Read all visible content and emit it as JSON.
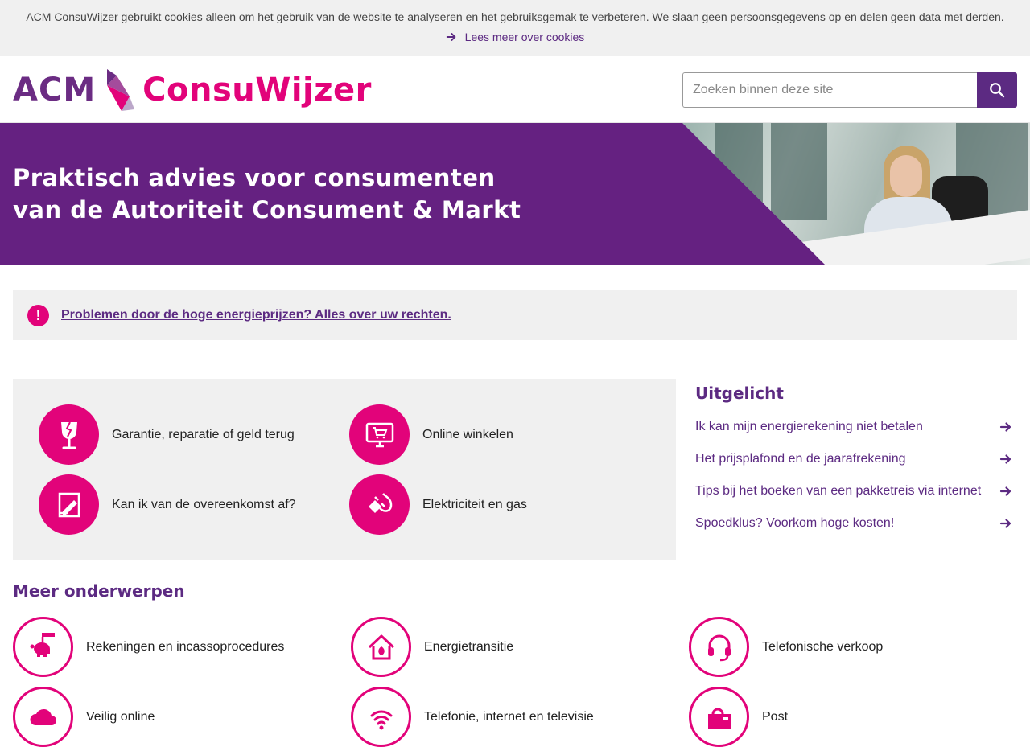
{
  "cookie": {
    "text": "ACM ConsuWijzer gebruikt cookies alleen om het gebruik van de website te analyseren en het gebruiksgemak te verbeteren. We slaan geen persoonsgegevens op en delen geen data met derden.",
    "link": "Lees meer over cookies"
  },
  "header": {
    "logo_acm": "ACM",
    "logo_name": "ConsuWijzer",
    "search_placeholder": "Zoeken binnen deze site"
  },
  "hero": {
    "line1": "Praktisch advies voor consumenten",
    "line2": "van de Autoriteit Consument & Markt"
  },
  "alert": {
    "icon": "!",
    "text": "Problemen door de hoge energieprijzen? Alles over uw rechten."
  },
  "topics": [
    {
      "label": "Garantie, reparatie of geld terug",
      "icon": "broken-glass-icon"
    },
    {
      "label": "Online winkelen",
      "icon": "monitor-cart-icon"
    },
    {
      "label": "Kan ik van de overeenkomst af?",
      "icon": "contract-icon"
    },
    {
      "label": "Elektriciteit en gas",
      "icon": "plug-icon"
    }
  ],
  "featured": {
    "title": "Uitgelicht",
    "items": [
      "Ik kan mijn energierekening niet betalen",
      "Het prijsplafond en de jaarafrekening",
      "Tips bij het boeken van een pakketreis via internet",
      "Spoedklus? Voorkom hoge kosten!"
    ]
  },
  "more": {
    "title": "Meer onderwerpen",
    "items": [
      {
        "label": "Rekeningen en incassoprocedures",
        "icon": "piggy-bank-icon"
      },
      {
        "label": "Energietransitie",
        "icon": "green-house-icon"
      },
      {
        "label": "Telefonische verkoop",
        "icon": "headset-icon"
      },
      {
        "label": "Veilig online",
        "icon": "cloud-lock-icon"
      },
      {
        "label": "Telefonie, internet en televisie",
        "icon": "wifi-icon"
      },
      {
        "label": "Post",
        "icon": "mailbox-icon"
      }
    ]
  },
  "colors": {
    "purple": "#652181",
    "magenta": "#e2037a",
    "link": "#5c2a82"
  }
}
